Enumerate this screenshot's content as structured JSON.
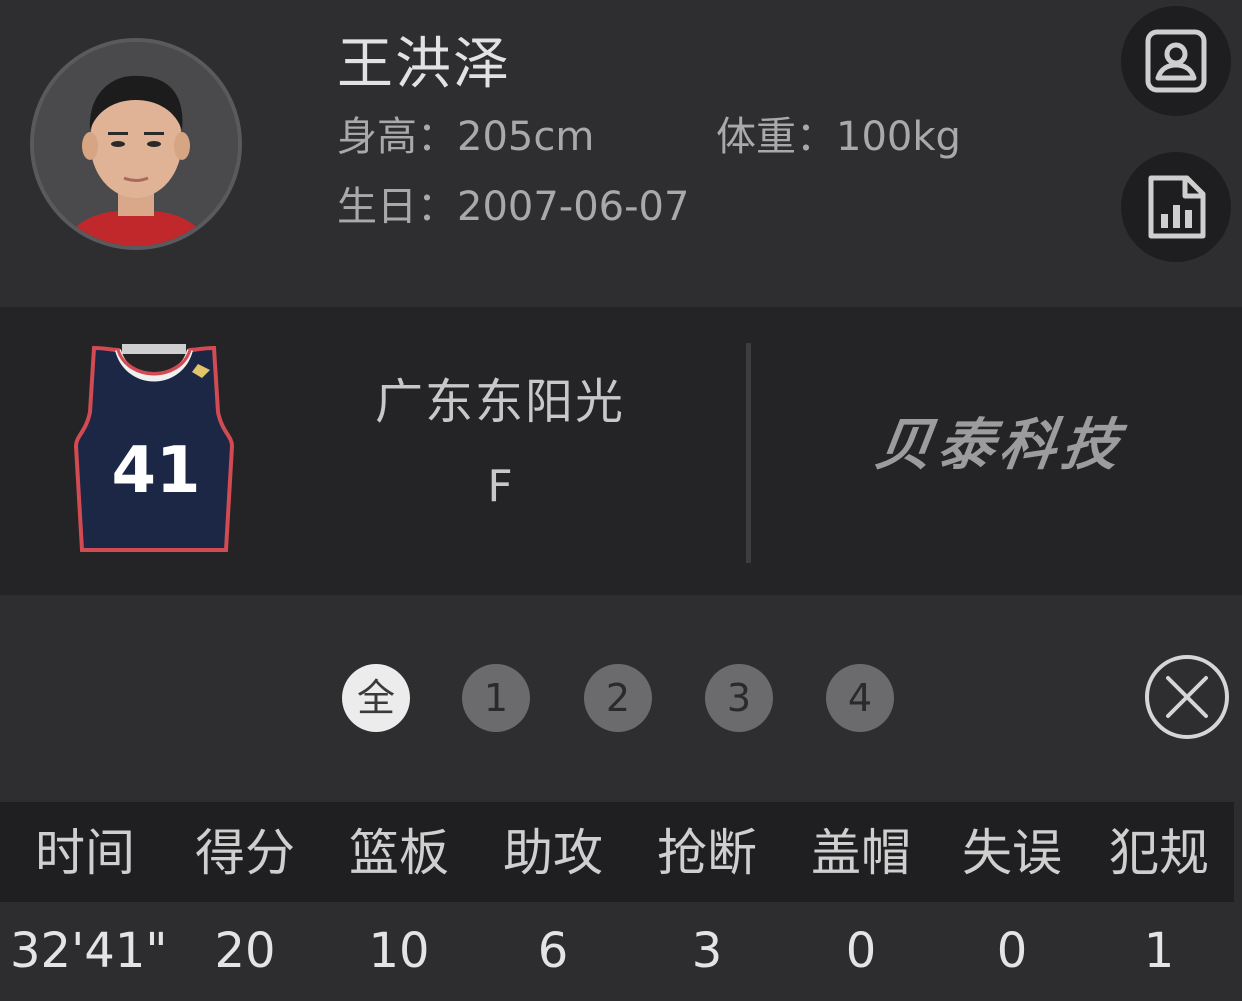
{
  "player": {
    "name": "王洪泽",
    "height_line": "身高：205cm",
    "weight_line": "体重：100kg",
    "birthday_line": "生日：2007-06-07"
  },
  "team": {
    "name": "广东东阳光",
    "position": "F",
    "jersey_number": "41"
  },
  "sponsor": {
    "logo_text": "贝泰科技"
  },
  "periods": [
    "全",
    "1",
    "2",
    "3",
    "4"
  ],
  "active_period": "全",
  "stats": {
    "headers": [
      "时间",
      "得分",
      "篮板",
      "助攻",
      "抢断",
      "盖帽",
      "失误",
      "犯规"
    ],
    "values": [
      "32'41\"",
      "20",
      "10",
      "6",
      "3",
      "0",
      "0",
      "1"
    ]
  },
  "icons": {
    "profile": "contact-card-icon",
    "stats": "bar-chart-document-icon",
    "close": "close-circle-icon"
  },
  "colors": {
    "background": "#2e2e31",
    "band": "#242426",
    "active_period": "#ececec",
    "inactive_period": "#6b6b6e"
  }
}
